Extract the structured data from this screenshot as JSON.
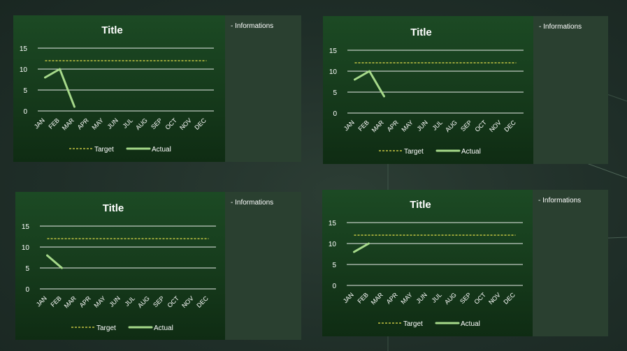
{
  "colors": {
    "target": "#e6e04a",
    "actual": "#a6d98a",
    "grid": "#ffffff",
    "text": "#ffffff"
  },
  "chart_data": [
    {
      "type": "line",
      "title": "Title",
      "categories": [
        "JAN",
        "FEB",
        "MAR",
        "APR",
        "MAY",
        "JUN",
        "JUL",
        "AUG",
        "SEP",
        "OCT",
        "NOV",
        "DEC"
      ],
      "ylim": [
        0,
        15
      ],
      "yticks": [
        "0",
        "5",
        "10",
        "15"
      ],
      "series": [
        {
          "name": "Target",
          "style": "dashed",
          "values": [
            12,
            12,
            12,
            12,
            12,
            12,
            12,
            12,
            12,
            12,
            12,
            12
          ]
        },
        {
          "name": "Actual",
          "style": "solid",
          "values": [
            8,
            10,
            1,
            null,
            null,
            null,
            null,
            null,
            null,
            null,
            null,
            null
          ]
        }
      ],
      "legend": "bottom",
      "info_label": "Informations"
    },
    {
      "type": "line",
      "title": "Title",
      "categories": [
        "JAN",
        "FEB",
        "MAR",
        "APR",
        "MAY",
        "JUN",
        "JUL",
        "AUG",
        "SEP",
        "OCT",
        "NOV",
        "DEC"
      ],
      "ylim": [
        0,
        15
      ],
      "yticks": [
        "0",
        "5",
        "10",
        "15"
      ],
      "series": [
        {
          "name": "Target",
          "style": "dashed",
          "values": [
            12,
            12,
            12,
            12,
            12,
            12,
            12,
            12,
            12,
            12,
            12,
            12
          ]
        },
        {
          "name": "Actual",
          "style": "solid",
          "values": [
            8,
            10,
            4,
            null,
            null,
            null,
            null,
            null,
            null,
            null,
            null,
            null
          ]
        }
      ],
      "legend": "bottom",
      "info_label": "Informations"
    },
    {
      "type": "line",
      "title": "Title",
      "categories": [
        "JAN",
        "FEB",
        "MAR",
        "APR",
        "MAY",
        "JUN",
        "JUL",
        "AUG",
        "SEP",
        "OCT",
        "NOV",
        "DEC"
      ],
      "ylim": [
        0,
        15
      ],
      "yticks": [
        "0",
        "5",
        "10",
        "15"
      ],
      "series": [
        {
          "name": "Target",
          "style": "dashed",
          "values": [
            12,
            12,
            12,
            12,
            12,
            12,
            12,
            12,
            12,
            12,
            12,
            12
          ]
        },
        {
          "name": "Actual",
          "style": "solid",
          "values": [
            8,
            5,
            null,
            null,
            null,
            null,
            null,
            null,
            null,
            null,
            null,
            null
          ]
        }
      ],
      "legend": "bottom",
      "info_label": "Informations"
    },
    {
      "type": "line",
      "title": "Title",
      "categories": [
        "JAN",
        "FEB",
        "MAR",
        "APR",
        "MAY",
        "JUN",
        "JUL",
        "AUG",
        "SEP",
        "OCT",
        "NOV",
        "DEC"
      ],
      "ylim": [
        0,
        15
      ],
      "yticks": [
        "0",
        "5",
        "10",
        "15"
      ],
      "series": [
        {
          "name": "Target",
          "style": "dashed",
          "values": [
            12,
            12,
            12,
            12,
            12,
            12,
            12,
            12,
            12,
            12,
            12,
            12
          ]
        },
        {
          "name": "Actual",
          "style": "solid",
          "values": [
            8,
            10,
            null,
            null,
            null,
            null,
            null,
            null,
            null,
            null,
            null,
            null
          ]
        }
      ],
      "legend": "bottom",
      "info_label": "Informations"
    }
  ]
}
